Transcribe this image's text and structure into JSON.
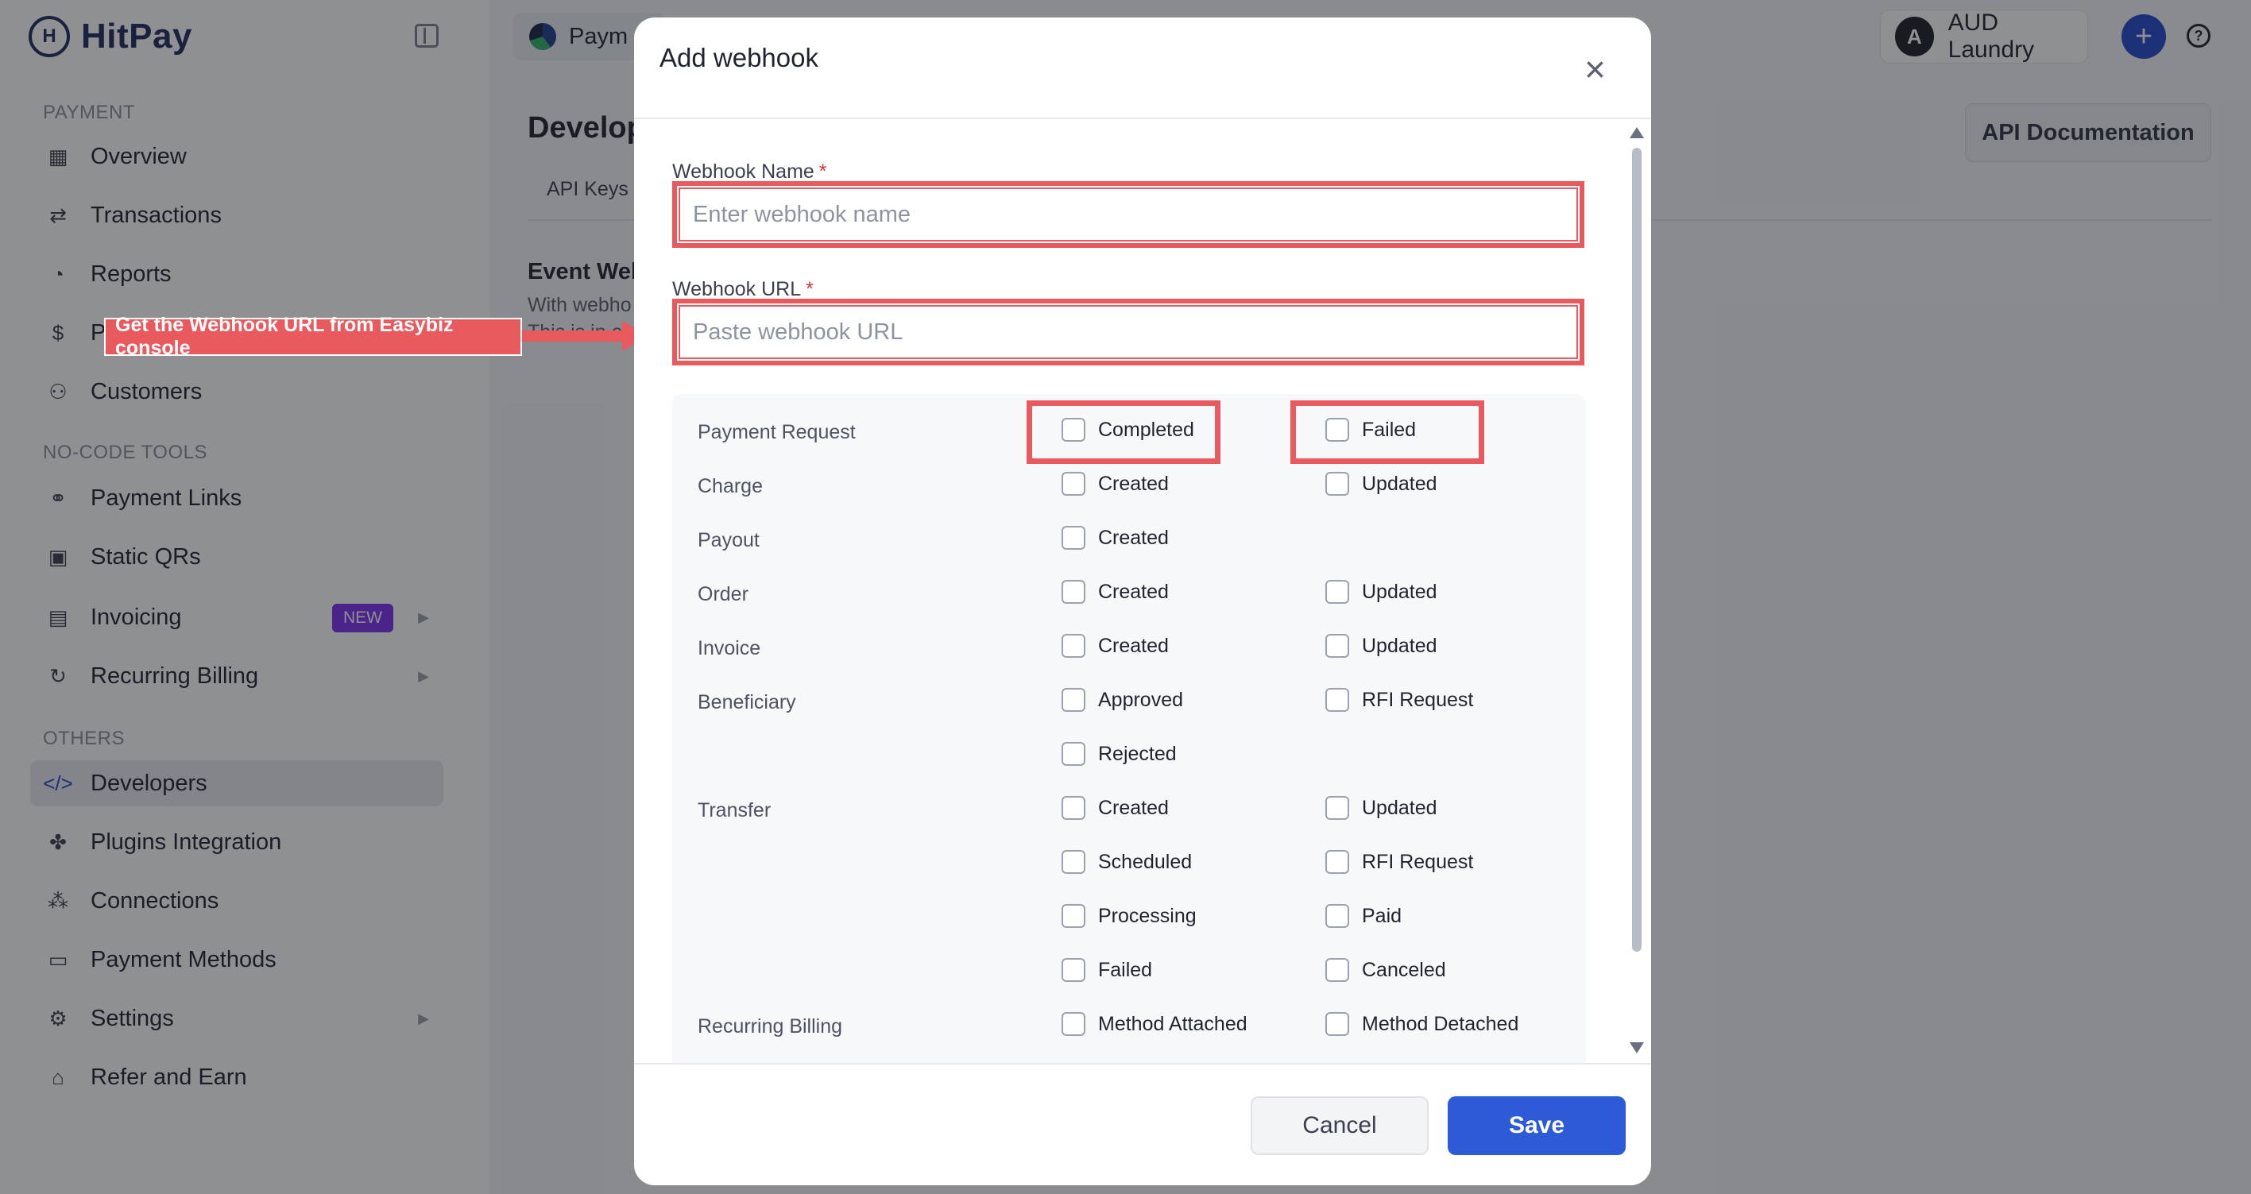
{
  "app": {
    "logo_text": "HitPay",
    "logo_mark": "H"
  },
  "sidebar": {
    "sections": [
      {
        "label": "PAYMENT"
      },
      {
        "label": "NO-CODE TOOLS"
      },
      {
        "label": "OTHERS"
      }
    ],
    "items": [
      {
        "label": "Overview",
        "icon": "grid-icon"
      },
      {
        "label": "Transactions",
        "icon": "swap-icon"
      },
      {
        "label": "Reports",
        "icon": "pie-icon"
      },
      {
        "label": "P",
        "icon": "receipt-icon"
      },
      {
        "label": "Customers",
        "icon": "users-icon"
      },
      {
        "label": "Payment Links",
        "icon": "link-icon"
      },
      {
        "label": "Static QRs",
        "icon": "qr-icon"
      },
      {
        "label": "Invoicing",
        "icon": "document-icon",
        "badge": "NEW"
      },
      {
        "label": "Recurring Billing",
        "icon": "repeat-icon"
      },
      {
        "label": "Developers",
        "icon": "code-icon"
      },
      {
        "label": "Plugins Integration",
        "icon": "puzzle-icon"
      },
      {
        "label": "Connections",
        "icon": "nodes-icon"
      },
      {
        "label": "Payment Methods",
        "icon": "card-icon"
      },
      {
        "label": "Settings",
        "icon": "gear-icon"
      },
      {
        "label": "Refer and Earn",
        "icon": "gift-icon"
      }
    ]
  },
  "topbar": {
    "pill_label": "Paym",
    "account_initial": "A",
    "account_name": "AUD Laundry",
    "plus": "+",
    "help": "?"
  },
  "page": {
    "title": "Develop",
    "tab": "API Keys",
    "api_doc_button": "API Documentation",
    "section_head": "Event Web",
    "section_desc": "With webho",
    "section_desc2": "This is in e"
  },
  "annotation": {
    "text": "Get the Webhook URL from Easybiz console"
  },
  "modal": {
    "title": "Add webhook",
    "close": "×",
    "name_label": "Webhook Name",
    "name_placeholder": "Enter webhook name",
    "url_label": "Webhook URL",
    "url_placeholder": "Paste webhook URL",
    "required_mark": "*",
    "events": {
      "payment_request": "Payment Request",
      "charge": "Charge",
      "payout": "Payout",
      "order": "Order",
      "invoice": "Invoice",
      "beneficiary": "Beneficiary",
      "transfer": "Transfer",
      "recurring_billing": "Recurring Billing",
      "opts": {
        "completed": "Completed",
        "failed": "Failed",
        "created": "Created",
        "updated": "Updated",
        "approved": "Approved",
        "rfi_request": "RFI Request",
        "rejected": "Rejected",
        "scheduled": "Scheduled",
        "processing": "Processing",
        "paid": "Paid",
        "canceled": "Canceled",
        "method_attached": "Method Attached",
        "method_detached": "Method Detached"
      }
    },
    "cancel": "Cancel",
    "save": "Save"
  }
}
